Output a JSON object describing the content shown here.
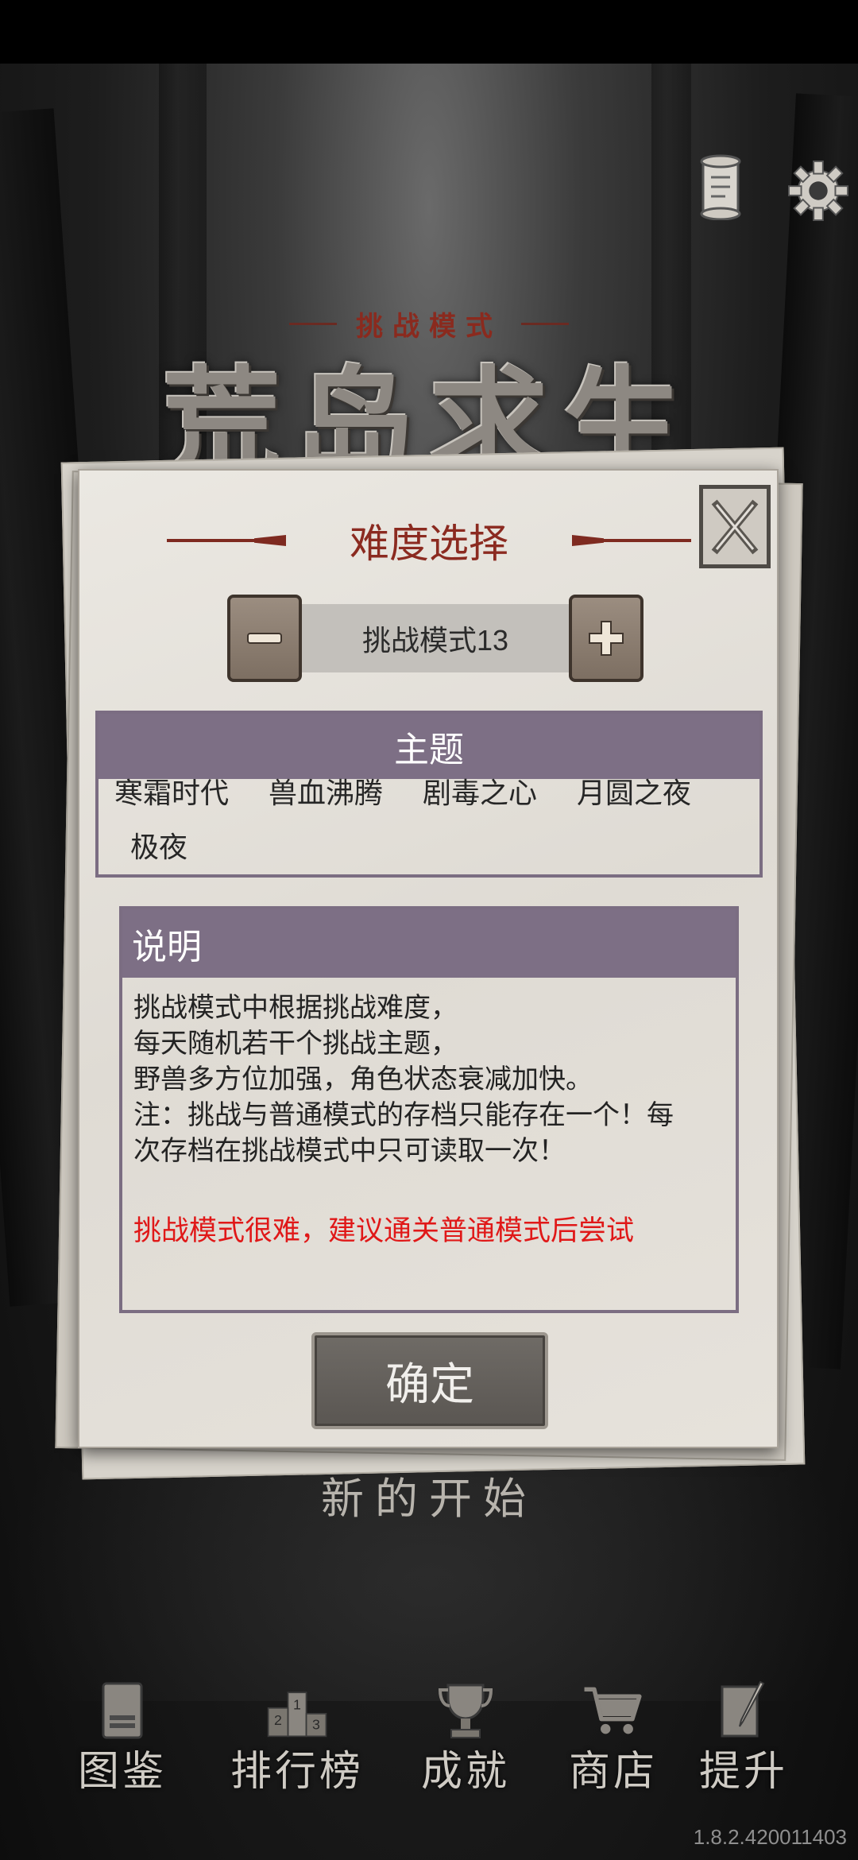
{
  "header": {
    "mode_title": "挑战模式",
    "logo_text": "荒岛求生"
  },
  "dialog": {
    "title": "难度选择",
    "stepper": {
      "minus_icon": "minus-icon",
      "value": "挑战模式13",
      "plus_icon": "plus-icon"
    },
    "themes": {
      "header": "主题",
      "items": [
        "寒霜时代",
        "兽血沸腾",
        "剧毒之心",
        "月圆之夜",
        "极夜"
      ]
    },
    "description": {
      "header": "说明",
      "lines": [
        "挑战模式中根据挑战难度，",
        "每天随机若干个挑战主题，",
        "野兽多方位加强，角色状态衰减加快。",
        "注：挑战与普通模式的存档只能存在一个！每",
        "次存档在挑战模式中只可读取一次！"
      ],
      "warning": "挑战模式很难，建议通关普通模式后尝试"
    },
    "confirm_label": "确定"
  },
  "new_start": "新的开始",
  "nav": {
    "items": [
      {
        "label": "图鉴",
        "icon": "book-icon"
      },
      {
        "label": "排行榜",
        "icon": "podium-icon"
      },
      {
        "label": "成就",
        "icon": "trophy-icon"
      },
      {
        "label": "商店",
        "icon": "cart-icon"
      },
      {
        "label": "提升",
        "icon": "quill-icon"
      }
    ]
  },
  "version": "1.8.2.420011403",
  "colors": {
    "title_red": "#8b2a20",
    "warning_red": "#e01818",
    "header_purple": "#7d6f85"
  }
}
